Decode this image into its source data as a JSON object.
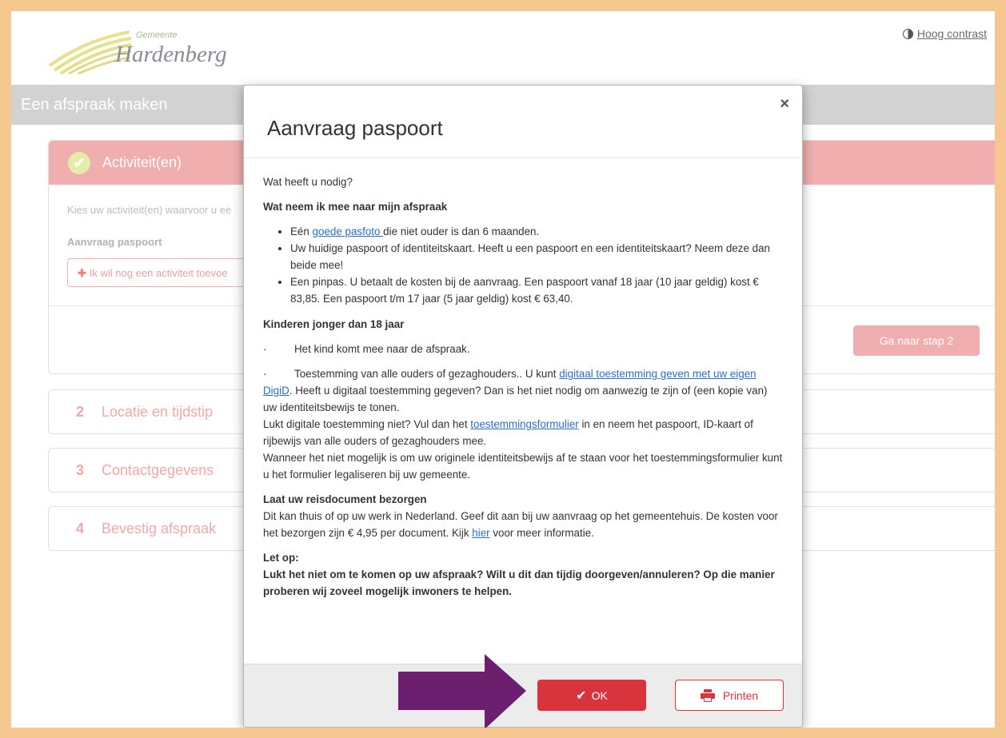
{
  "header": {
    "logo_small": "Gemeente",
    "logo_big": "Hardenberg",
    "contrast_label": "Hoog contrast",
    "page_title": "Een afspraak maken"
  },
  "step1": {
    "label": "Activiteit(en)",
    "intro": "Kies uw activiteit(en) waarvoor u ee",
    "activity": "Aanvraag paspoort",
    "add_button": "Ik wil nog een activiteit toevoe",
    "next_button": "Ga naar stap 2"
  },
  "steps": [
    {
      "num": "2",
      "label": "Locatie en tijdstip"
    },
    {
      "num": "3",
      "label": "Contactgegevens"
    },
    {
      "num": "4",
      "label": "Bevestig afspraak"
    }
  ],
  "modal": {
    "title": "Aanvraag paspoort",
    "close": "×",
    "intro": "Wat heeft u nodig?",
    "h1": "Wat neem ik mee naar mijn afspraak",
    "li1_pre": "Eén ",
    "li1_link": "goede pasfoto ",
    "li1_post": "die niet ouder is dan 6 maanden.",
    "li2": "Uw huidige paspoort of identiteitskaart. Heeft u een paspoort en een identiteitskaart? Neem deze dan beide mee!",
    "li3": "Een pinpas. U betaalt de kosten bij de aanvraag. Een paspoort vanaf 18 jaar (10 jaar geldig) kost € 83,85. Een paspoort t/m 17 jaar (5 jaar geldig) kost € 63,40.",
    "h2": "Kinderen jonger dan 18 jaar",
    "dot": "·",
    "kid1": "Het kind komt mee naar de afspraak.",
    "kid2_pre": "Toestemming van alle ouders of gezaghouders.. U kunt ",
    "kid2_link": "digitaal toestemming geven met uw eigen DigiD",
    "kid2_post": ". Heeft u digitaal toestemming gegeven? Dan is het niet nodig om aanwezig te zijn of (een kopie van) uw identiteitsbewijs te tonen.",
    "kid3_pre": "Lukt digitale toestemming niet? Vul dan het ",
    "kid3_link": "toestemmingsformulier",
    "kid3_post": " in en neem het paspoort, ID-kaart of rijbewijs van alle ouders of gezaghouders mee.",
    "kid4": "Wanneer het niet mogelijk is om uw originele identiteitsbewijs af te staan voor het toestemmingsformulier kunt u het formulier legaliseren bij uw gemeente.",
    "h3": "Laat uw reisdocument bezorgen",
    "deliv_pre": "Dit kan thuis of op uw werk in Nederland. Geef dit aan bij uw aanvraag op het gemeentehuis. De kosten voor het bezorgen zijn € 4,95 per document. Kijk ",
    "deliv_link": "hier",
    "deliv_post": " voor meer informatie.",
    "h4": "Let op:",
    "warn": "Lukt het niet om te komen op uw afspraak? Wilt u dit dan tijdig doorgeven/annuleren? Op die manier proberen wij zoveel mogelijk inwoners te helpen.",
    "ok_label": "OK",
    "print_label": "Printen"
  },
  "colors": {
    "page_border": "#f6c88f",
    "accent_red": "#d9343d",
    "step_pink": "#f0aeae",
    "arrow_purple": "#6c1f6e",
    "link_blue": "#2a6fc0"
  }
}
